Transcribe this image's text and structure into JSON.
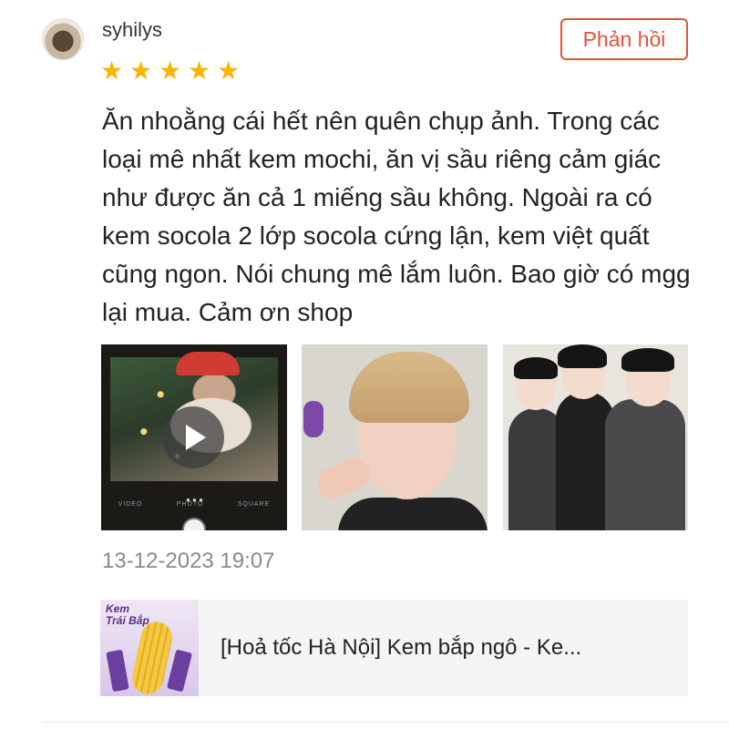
{
  "review": {
    "username": "syhilys",
    "avatar_icon": "user-avatar",
    "reply_label": "Phản hồi",
    "rating": 5,
    "rating_max": 5,
    "star_color": "#f7b500",
    "accent_color": "#e0533a",
    "text": "Ăn nhoằng cái hết nên quên chụp ảnh. Trong các loại mê nhất kem mochi, ăn vị sầu riêng cảm giác như được ăn cả 1 miếng sầu không. Ngoài ra có kem socola 2 lớp socola cứng lận, kem việt quất cũng ngon. Nói chung mê lắm luôn. Bao giờ có mgg lại mua. Cảm ơn shop",
    "timestamp": "13-12-2023 19:07",
    "media": [
      {
        "kind": "video",
        "icon": "play-icon",
        "camera_modes": [
          "VIDEO",
          "PHOTO",
          "SQUARE"
        ]
      },
      {
        "kind": "photo"
      },
      {
        "kind": "photo"
      }
    ]
  },
  "product": {
    "name": "[Hoả tốc Hà Nội] Kem bắp ngô - Ke...",
    "thumbnail_text": [
      "Kem",
      "Trái Bắp"
    ]
  }
}
